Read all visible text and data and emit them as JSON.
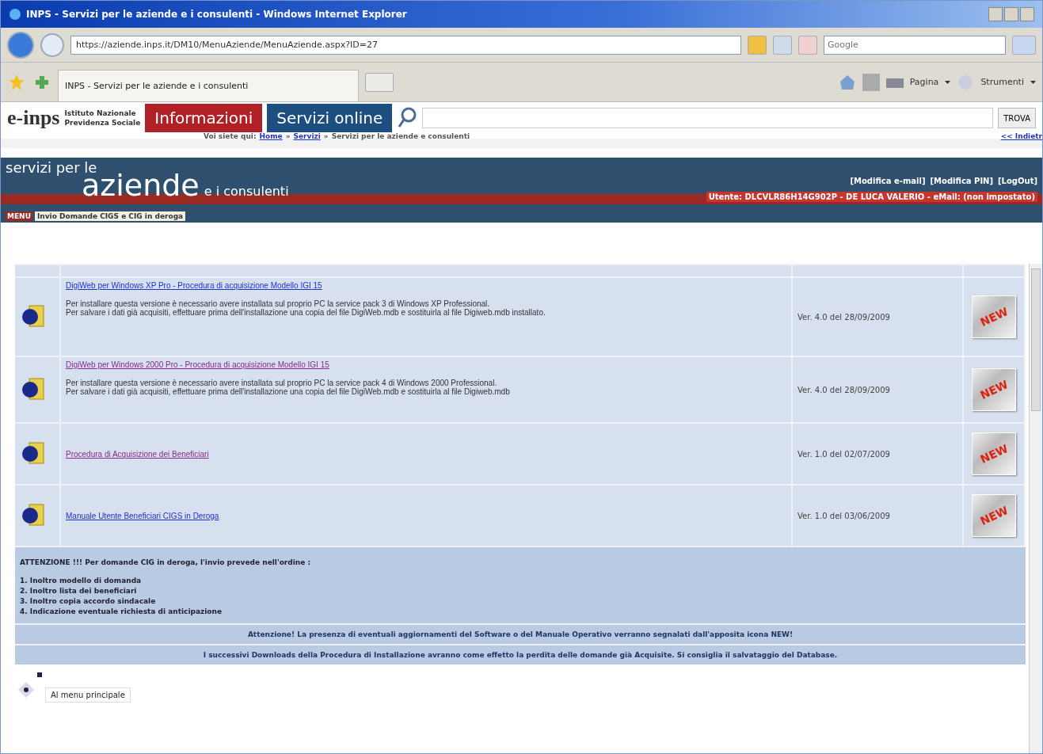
{
  "window": {
    "title": "INPS - Servizi per le aziende e i consulenti - Windows Internet Explorer"
  },
  "address_bar": {
    "url": "https://aziende.inps.it/DM10/MenuAziende/MenuAziende.aspx?ID=27",
    "search_placeholder": "Google"
  },
  "browser_tab": {
    "title": "INPS - Servizi per le aziende e i consulenti"
  },
  "command_bar": [
    "Pagina",
    "Strumenti"
  ],
  "site_header": {
    "logo": "e-inps",
    "institute": [
      "Istituto Nazionale",
      "Previdenza Sociale"
    ],
    "tabs": [
      {
        "label": "Informazioni",
        "kind": "info"
      },
      {
        "label": "Servizi online",
        "kind": "services"
      }
    ],
    "search_button": "TROVA",
    "breadcrumb": {
      "prefix": "Voi siete qui:",
      "links": [
        "Home",
        "Servizi"
      ],
      "separator": "»",
      "current": "Servizi per le aziende e consulenti"
    },
    "back_link": "<< Indietr"
  },
  "banner": {
    "line1": "servizi per le",
    "line2": "aziende",
    "line3": "e i consulenti",
    "links": [
      "[Modifica e-mail]",
      "[Modifica PIN]",
      "[LogOut]"
    ],
    "user": "Utente: DLCVLR86H14G902P - DE LUCA VALERIO - eMail: (non impostato)"
  },
  "menu_bar": {
    "label": "MENU",
    "item": "Invio Domande CIGS e CIG in deroga"
  },
  "downloads": [
    {
      "title": "DigiWeb per Windows XP Pro - Procedura di acquisizione Modello IGI 15",
      "visited": false,
      "description": [
        "Per installare questa versione è necessario avere installata sul proprio PC la service pack 3 di Windows XP Professional.",
        "Per salvare i dati già acquisiti, effettuare prima dell'installazione una copia del file DigiWeb.mdb e sostituirla al file Digiweb.mdb installato."
      ],
      "version": "Ver. 4.0 del 28/09/2009",
      "badge": "NEW"
    },
    {
      "title": "DigiWeb per Windows 2000 Pro - Procedura di acquisizione Modello IGI 15",
      "visited": true,
      "description": [
        "Per installare questa versione è necessario avere installata sul proprio PC la service pack 4 di Windows 2000 Professional.",
        "Per salvare i dati già acquisiti, effettuare prima dell'installazione una copia del file DigiWeb.mdb e sostituirla al file Digiweb.mdb"
      ],
      "version": "Ver. 4.0 del 28/09/2009",
      "badge": "NEW"
    },
    {
      "title": "Procedura di Acquisizione dei Beneficiari",
      "visited": true,
      "version": "Ver. 1.0 del 02/07/2009",
      "badge": "NEW"
    },
    {
      "title": "Manuale Utente Beneficiari CIGS in Deroga",
      "visited": false,
      "version": "Ver. 1.0 del 03/06/2009",
      "badge": "NEW"
    }
  ],
  "notice": {
    "heading": "ATTENZIONE !!! Per domande CIG in deroga, l'invio prevede nell'ordine :",
    "steps": [
      "1. Inoltro modello di domanda",
      "2. Inoltro lista dei beneficiari",
      "3. Inoltro copia accordo sindacale",
      "4. Indicazione eventuale richiesta di anticipazione"
    ]
  },
  "info_lines": [
    "Attenzione! La presenza di eventuali aggiornamenti del Software o del Manuale Operativo verranno segnalati dall'apposita icona NEW!",
    "I successivi Downloads della Procedura di Installazione avranno come effetto la perdita delle domande già Acquisite. Si consiglia il salvataggio del Database."
  ],
  "footer_link": "Al menu principale"
}
